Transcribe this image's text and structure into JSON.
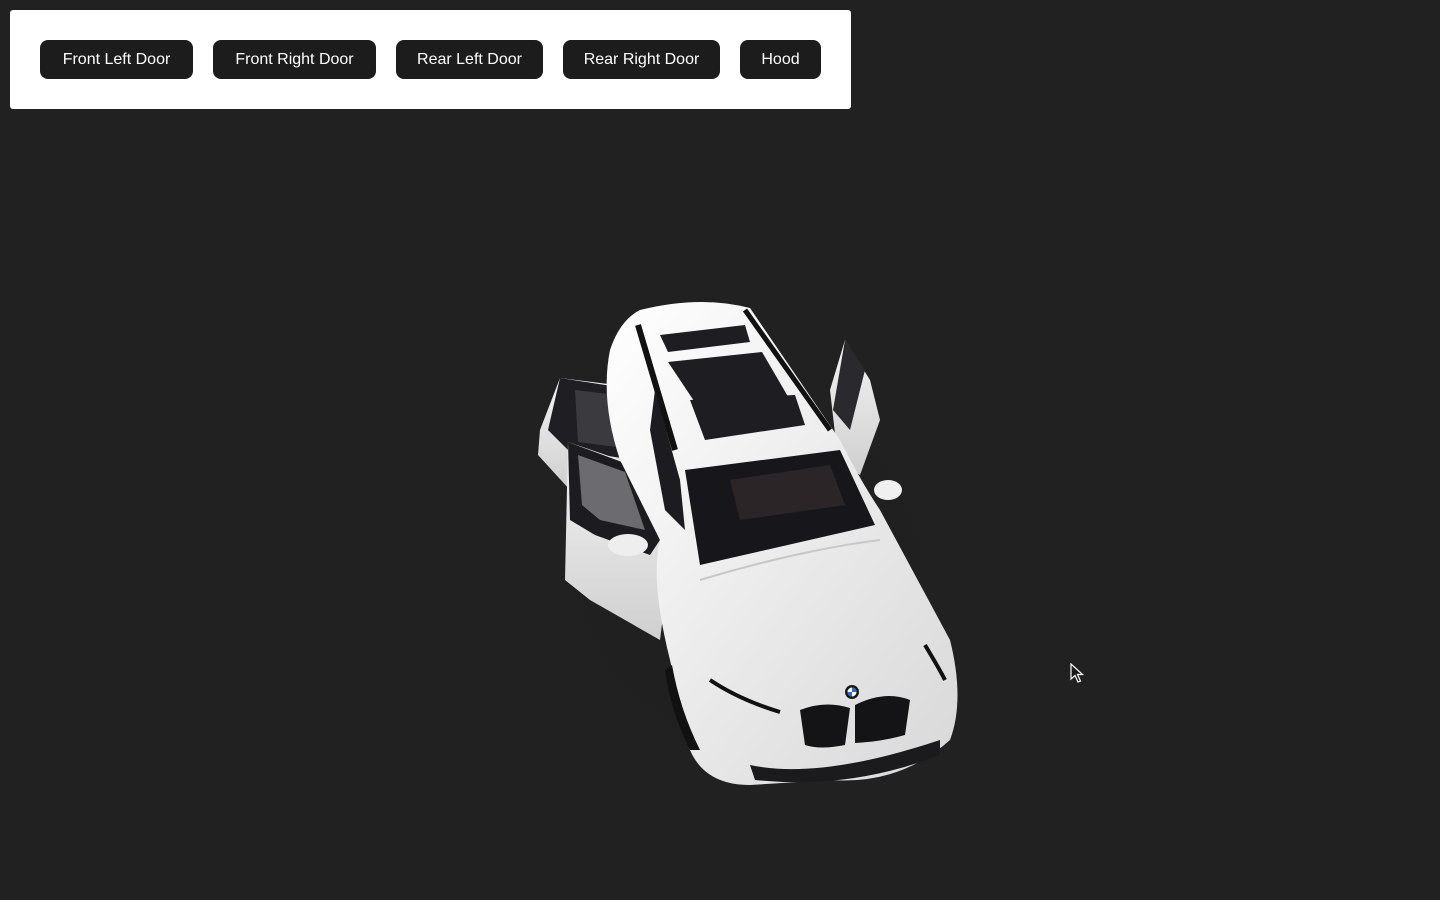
{
  "controls": {
    "front_left_door": "Front Left Door",
    "front_right_door": "Front Right Door",
    "rear_left_door": "Rear Left Door",
    "rear_right_door": "Rear Right Door",
    "hood": "Hood"
  },
  "scene": {
    "background": "#212121",
    "model_color": "#f2f2f2",
    "glass_color": "#1a1a1e",
    "button_color": "#1c1c1c",
    "icons": [
      "bmw-roundel-icon",
      "mouse-cursor-icon"
    ]
  }
}
